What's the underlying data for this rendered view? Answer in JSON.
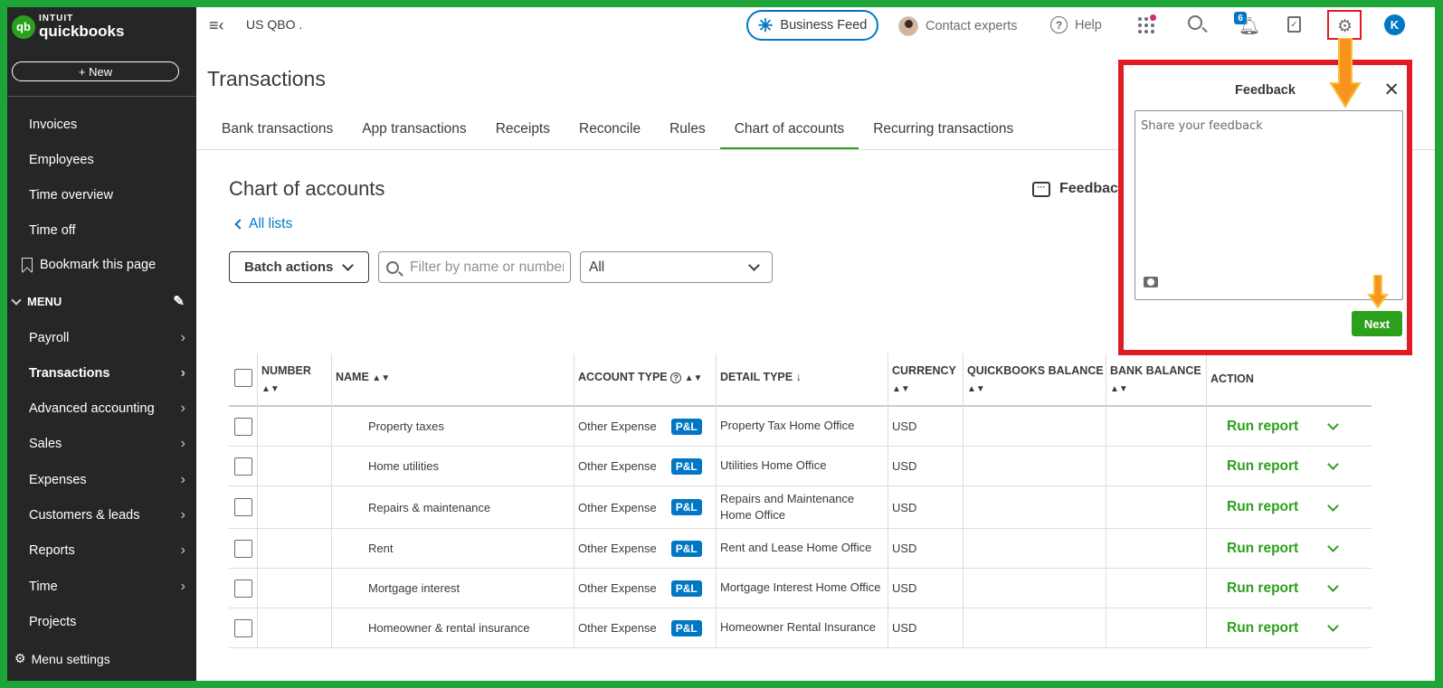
{
  "app": {
    "brand_top": "INTUIT",
    "brand_name": "quickbooks",
    "company": "US QBO ."
  },
  "sidebar": {
    "new_label": "+ New",
    "top_items": [
      "Invoices",
      "Employees",
      "Time overview",
      "Time off"
    ],
    "bookmark": "Bookmark this page",
    "menu_header": "MENU",
    "menu_items": [
      "Payroll",
      "Transactions",
      "Advanced accounting",
      "Sales",
      "Expenses",
      "Customers & leads",
      "Reports",
      "Time",
      "Projects"
    ],
    "active_item": "Transactions",
    "footer": "Menu settings"
  },
  "topbar": {
    "business_feed": "Business Feed",
    "contact": "Contact experts",
    "help": "Help",
    "notification_count": "6",
    "user_initial": "K"
  },
  "page": {
    "title": "Transactions",
    "tabs": [
      "Bank transactions",
      "App transactions",
      "Receipts",
      "Reconcile",
      "Rules",
      "Chart of accounts",
      "Recurring transactions"
    ],
    "active_tab": "Chart of accounts",
    "section_title": "Chart of accounts",
    "all_lists": "All lists",
    "feedback_link": "Feedbac",
    "batch_actions": "Batch actions",
    "filter_placeholder": "Filter by name or number",
    "type_filter_value": "All"
  },
  "table": {
    "columns": [
      "NUMBER",
      "NAME",
      "ACCOUNT TYPE",
      "DETAIL TYPE",
      "CURRENCY",
      "QUICKBOOKS BALANCE",
      "BANK BALANCE",
      "ACTION"
    ],
    "rows": [
      {
        "name": "Property taxes",
        "account_type": "Other Expense",
        "badge": "P&L",
        "detail_type": "Property Tax Home Office",
        "currency": "USD",
        "action": "Run report"
      },
      {
        "name": "Home utilities",
        "account_type": "Other Expense",
        "badge": "P&L",
        "detail_type": "Utilities Home Office",
        "currency": "USD",
        "action": "Run report"
      },
      {
        "name": "Repairs & maintenance",
        "account_type": "Other Expense",
        "badge": "P&L",
        "detail_type": "Repairs and Maintenance Home Office",
        "currency": "USD",
        "action": "Run report"
      },
      {
        "name": "Rent",
        "account_type": "Other Expense",
        "badge": "P&L",
        "detail_type": "Rent and Lease Home Office",
        "currency": "USD",
        "action": "Run report"
      },
      {
        "name": "Mortgage interest",
        "account_type": "Other Expense",
        "badge": "P&L",
        "detail_type": "Mortgage Interest Home Office",
        "currency": "USD",
        "action": "Run report"
      },
      {
        "name": "Homeowner & rental insurance",
        "account_type": "Other Expense",
        "badge": "P&L",
        "detail_type": "Homeowner Rental Insurance",
        "currency": "USD",
        "action": "Run report"
      }
    ]
  },
  "feedback_panel": {
    "title": "Feedback",
    "placeholder": "Share your feedback",
    "next_label": "Next"
  },
  "colors": {
    "brand_green": "#2ca01c",
    "frame_green": "#1ea538",
    "highlight_red": "#e01b24",
    "link_blue": "#0077c5",
    "arrow_orange": "#f7931e"
  }
}
